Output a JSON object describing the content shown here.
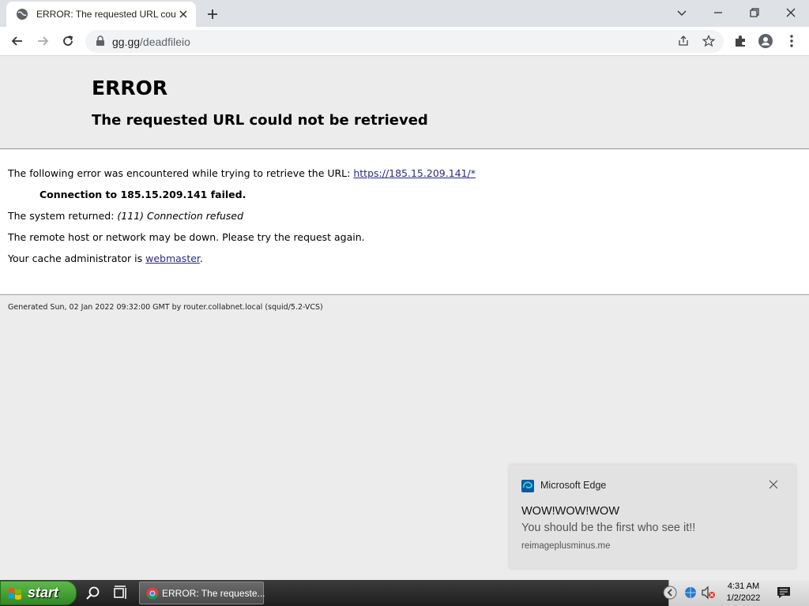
{
  "browser": {
    "tab_title": "ERROR: The requested URL could not be retrieved",
    "url_host": "gg.gg",
    "url_path": "/deadfileio"
  },
  "page": {
    "heading": "ERROR",
    "subheading": "The requested URL could not be retrieved",
    "intro": "The following error was encountered while trying to retrieve the URL: ",
    "url_link": "https://185.15.209.141/*",
    "failure": "Connection to 185.15.209.141 failed.",
    "system_prefix": "The system returned: ",
    "system_error": "(111) Connection refused",
    "remote_msg": "The remote host or network may be down. Please try the request again.",
    "cache_prefix": "Your cache administrator is ",
    "cache_link": "webmaster",
    "cache_suffix": ".",
    "footer": "Generated Sun, 02 Jan 2022 09:32:00 GMT by router.collabnet.local (squid/5.2-VCS)"
  },
  "notification": {
    "app": "Microsoft Edge",
    "title": "WOW!WOW!WOW",
    "message": "You should be the first who see it!!",
    "source": "reimageplusminus.me"
  },
  "taskbar": {
    "start_label": "start",
    "task_label": "ERROR: The requeste...",
    "time": "4:31 AM",
    "date": "1/2/2022"
  },
  "colors": {
    "link": "#2a2a8a",
    "start_green": "#318a23"
  }
}
